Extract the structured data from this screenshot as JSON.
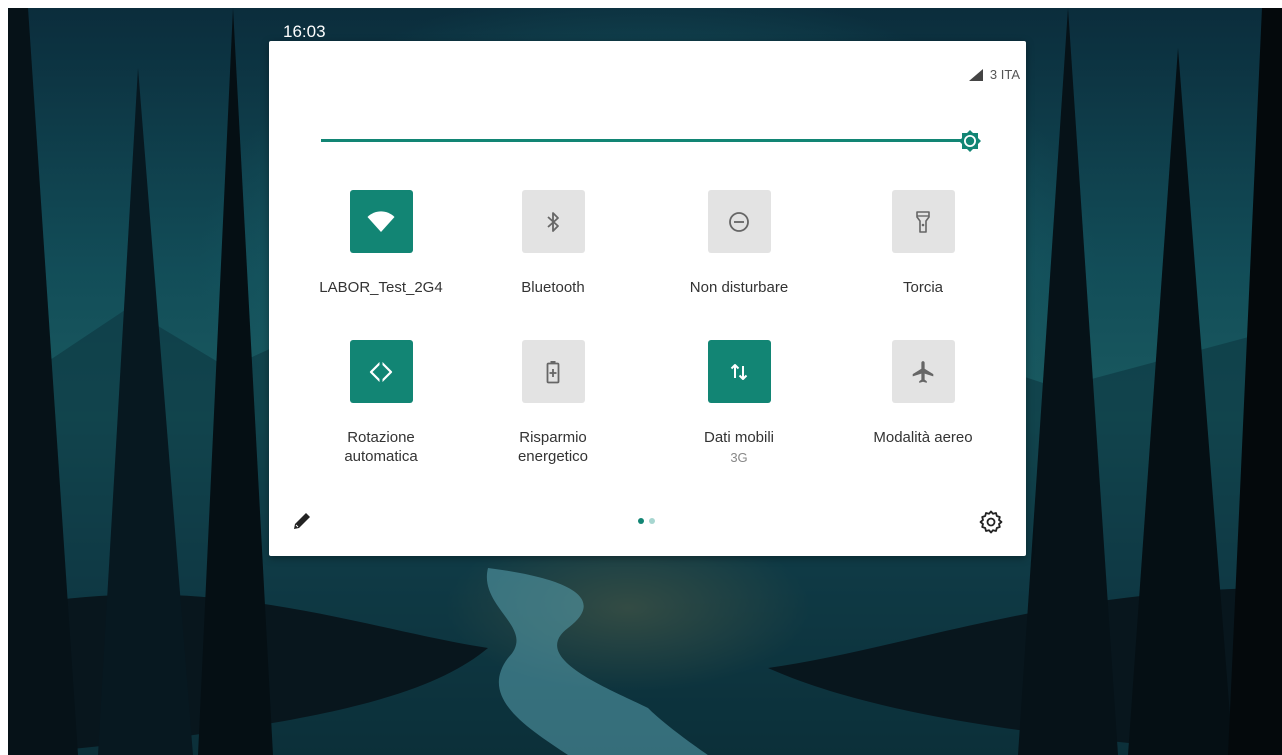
{
  "status_bar": {
    "time": "16:03"
  },
  "quick_settings": {
    "network": {
      "signal_icon": "cell-signal-icon",
      "carrier": "3 ITA"
    },
    "brightness": {
      "level_fraction": 1.0,
      "accent": "#128574"
    },
    "tiles": [
      {
        "label": "LABOR_Test_2G4",
        "icon": "wifi-icon",
        "active": true
      },
      {
        "label": "Bluetooth",
        "icon": "bluetooth-icon",
        "active": false
      },
      {
        "label": "Non disturbare",
        "icon": "do-not-disturb-icon",
        "active": false
      },
      {
        "label": "Torcia",
        "icon": "flashlight-icon",
        "active": false
      },
      {
        "label": "Rotazione automatica",
        "icon": "auto-rotate-icon",
        "active": true
      },
      {
        "label": "Risparmio energetico",
        "icon": "battery-saver-icon",
        "active": false
      },
      {
        "label": "Dati mobili",
        "sublabel": "3G",
        "icon": "mobile-data-icon",
        "active": true
      },
      {
        "label": "Modalità aereo",
        "icon": "airplane-icon",
        "active": false
      }
    ],
    "pager": {
      "pages": 2,
      "current": 1
    },
    "colors": {
      "accent": "#128574",
      "tile_off": "#e3e3e3",
      "icon_off": "#666666"
    }
  }
}
